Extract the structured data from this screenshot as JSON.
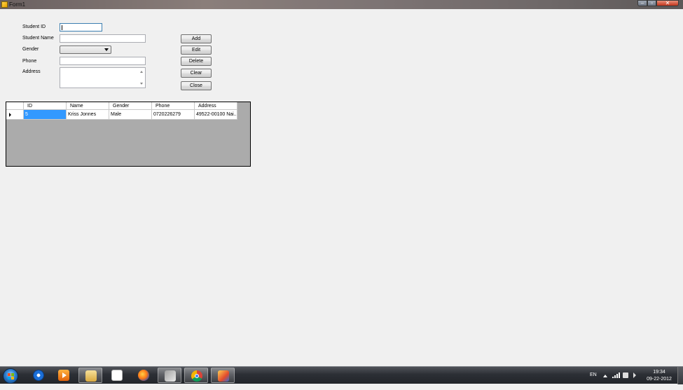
{
  "window": {
    "title": "Form1",
    "controls": {
      "minimize": "–",
      "maximize": "▫",
      "close": "✕"
    }
  },
  "form": {
    "labels": {
      "student_id": "Student ID",
      "student_name": "Student Name",
      "gender": "Gender",
      "phone": "Phone",
      "address": "Address"
    },
    "values": {
      "student_id": "",
      "student_name": "",
      "gender": "",
      "phone": "",
      "address": ""
    }
  },
  "buttons": {
    "add": "Add",
    "edit": "Edit",
    "delete": "Delete",
    "clear": "Clear",
    "close": "Close"
  },
  "grid": {
    "columns": [
      "ID",
      "Name",
      "Gender",
      "Phone",
      "Address"
    ],
    "rows": [
      [
        "5",
        "Kriss Jonnes",
        "Male",
        "0720226279",
        "49522-00100 Nai..."
      ]
    ]
  },
  "taskbar": {
    "apps": [
      "internet-explorer-icon",
      "media-player-icon",
      "file-explorer-icon",
      "notepad-icon",
      "firefox-icon",
      "visual-studio-icon",
      "chrome-icon",
      "form-app-icon"
    ],
    "tray": {
      "language": "EN",
      "time": "19:34",
      "date": "09-22-2012"
    }
  }
}
